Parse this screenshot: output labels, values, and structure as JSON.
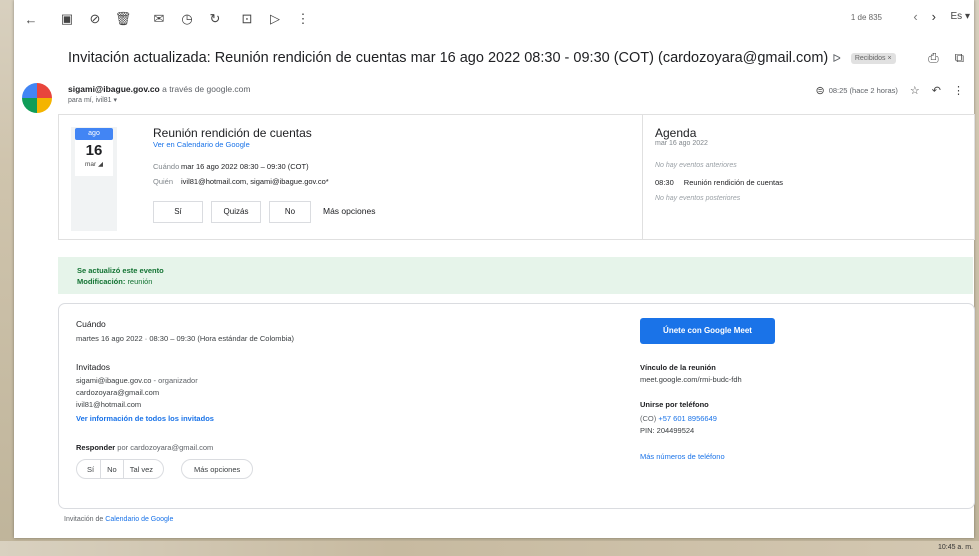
{
  "toolbar": {
    "pager": "1 de 835",
    "lang": "Es"
  },
  "email": {
    "subject": "Invitación actualizada: Reunión rendición de cuentas mar 16 ago 2022 08:30 - 09:30 (COT) (cardozoyara@gmail.com)",
    "label": "Recibidos ×",
    "sender": "sigami@ibague.gov.co",
    "via_prefix": "a través de",
    "via_domain": "google.com",
    "to": "para mí, ivil81 ▾",
    "time": "08:25 (hace 2 horas)"
  },
  "invite": {
    "month": "ago",
    "day": "16",
    "weekday": "mar",
    "title": "Reunión rendición de cuentas",
    "calendar_link": "Ver en Calendario de Google",
    "when_label": "Cuándo",
    "when_value": "mar 16 ago 2022 08:30 – 09:30 (COT)",
    "who_label": "Quién",
    "who_value": "ivil81@hotmail.com, sigami@ibague.gov.co*",
    "rsvp_yes": "Sí",
    "rsvp_maybe": "Quizás",
    "rsvp_no": "No",
    "more_options": "Más opciones"
  },
  "agenda": {
    "title": "Agenda",
    "date": "mar 16 ago 2022",
    "before": "No hay eventos anteriores",
    "event_time": "08:30",
    "event_name": "Reunión rendición de cuentas",
    "after": "No hay eventos posteriores"
  },
  "updated": {
    "line1": "Se actualizó este evento",
    "mod_label": "Modificación:",
    "mod_value": "reunión"
  },
  "details": {
    "when_heading": "Cuándo",
    "when_value": "martes 16 ago 2022 · 08:30 – 09:30 (Hora estándar de Colombia)",
    "guests_heading": "Invitados",
    "guest1": "sigami@ibague.gov.co",
    "guest1_role": "- organizador",
    "guest2": "cardozoyara@gmail.com",
    "guest3": "ivil81@hotmail.com",
    "all_guests_link": "Ver información de todos los invitados",
    "respond_label": "Responder",
    "respond_for": "por cardozoyara@gmail.com",
    "yes": "Sí",
    "no": "No",
    "maybe": "Tal vez",
    "more_options": "Más opciones",
    "meet_button": "Únete con Google Meet",
    "link_heading": "Vínculo de la reunión",
    "link_value": "meet.google.com/rmi-budc-fdh",
    "phone_heading": "Unirse por teléfono",
    "phone_prefix": "(CO)",
    "phone_number": "+57 601 8956649",
    "pin": "PIN: 204499524",
    "more_numbers": "Más números de teléfono"
  },
  "footer": {
    "prefix": "Invitación de",
    "link": "Calendario de Google"
  },
  "taskbar": {
    "clock": "10:45 a. m."
  }
}
